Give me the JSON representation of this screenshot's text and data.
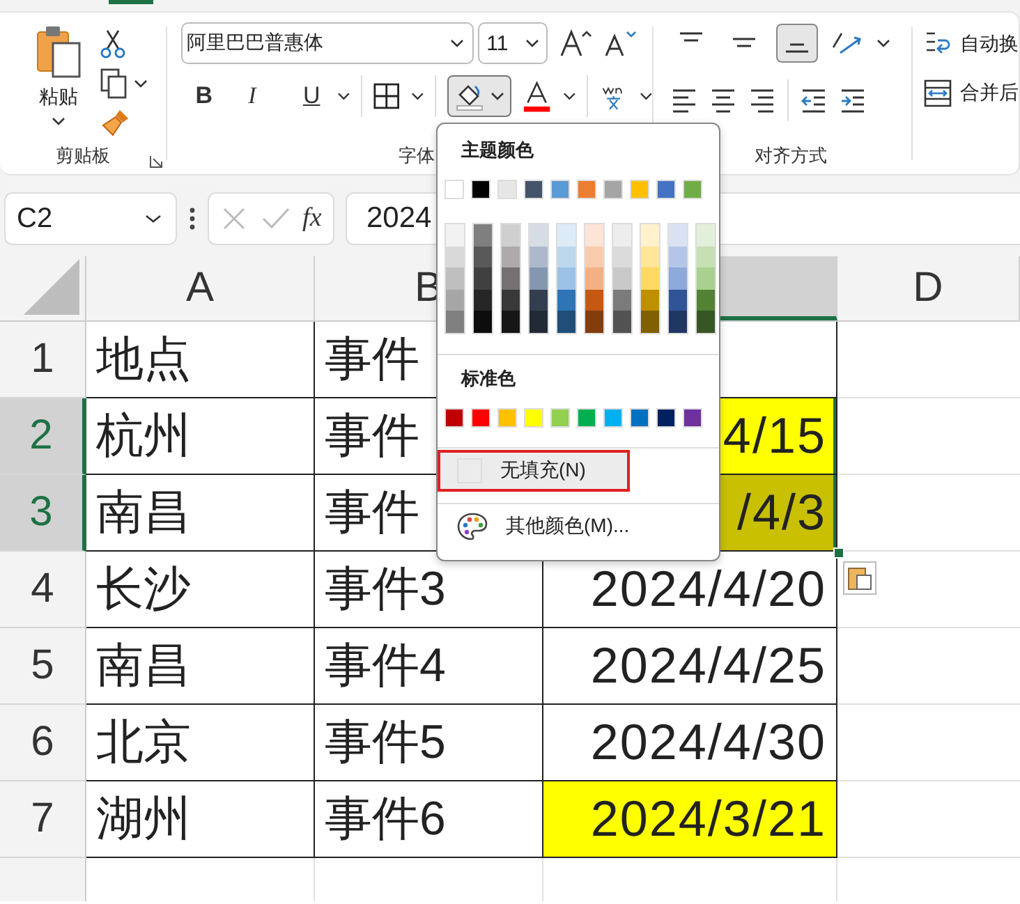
{
  "ribbon": {
    "clipboard": {
      "paste_label": "粘贴",
      "group_label": "剪贴板"
    },
    "font": {
      "font_name": "阿里巴巴普惠体",
      "font_size": "11",
      "bold": "B",
      "italic": "I",
      "underline": "U",
      "fill_pressed": true,
      "group_label": "字体"
    },
    "alignment": {
      "vertical": [
        {
          "kind": "top",
          "selected": false
        },
        {
          "kind": "middle",
          "selected": false
        },
        {
          "kind": "bottom",
          "selected": true
        }
      ],
      "wrap_label": "自动换",
      "merge_label": "合并后",
      "group_label": "对齐方式"
    }
  },
  "formula_bar": {
    "name_box": "C2",
    "fx": "fx",
    "value": "2024"
  },
  "columns": [
    {
      "label": "A",
      "selected": false
    },
    {
      "label": "B",
      "selected": false
    },
    {
      "selected": true
    },
    {
      "label": "D",
      "selected": false
    }
  ],
  "rows": [
    {
      "number": "1",
      "selected": false,
      "cells": [
        {
          "text": "地点"
        },
        {
          "text": "事件"
        },
        {},
        {}
      ]
    },
    {
      "number": "2",
      "selected": true,
      "cells": [
        {
          "text": "杭州"
        },
        {
          "text": "事件"
        },
        {
          "text": "4/15",
          "color": "#ffff00",
          "selected": true
        },
        {}
      ]
    },
    {
      "number": "3",
      "selected": true,
      "cells": [
        {
          "text": "南昌"
        },
        {
          "text": "事件"
        },
        {
          "text": "/4/3",
          "color": "#c8c000",
          "selected": true
        },
        {}
      ]
    },
    {
      "number": "4",
      "selected": false,
      "cells": [
        {
          "text": "长沙"
        },
        {
          "text": "事件3"
        },
        {
          "text": "2024/4/20",
          "selected": false
        },
        {}
      ]
    },
    {
      "number": "5",
      "selected": false,
      "cells": [
        {
          "text": "南昌"
        },
        {
          "text": "事件4"
        },
        {
          "text": "2024/4/25",
          "selected": false
        },
        {}
      ]
    },
    {
      "number": "6",
      "selected": false,
      "cells": [
        {
          "text": "北京"
        },
        {
          "text": "事件5"
        },
        {
          "text": "2024/4/30",
          "selected": false
        },
        {}
      ]
    },
    {
      "number": "7",
      "selected": false,
      "cells": [
        {
          "text": "湖州"
        },
        {
          "text": "事件6"
        },
        {
          "text": "2024/3/21",
          "color": "#ffff00",
          "selected": false
        },
        {}
      ]
    },
    {
      "cells": [
        {},
        {},
        {},
        {}
      ]
    }
  ],
  "fill_menu": {
    "theme_title": "主题颜色",
    "theme_colors": [
      {
        "color": "#ffffff"
      },
      {
        "color": "#000000"
      },
      {
        "color": "#e7e6e6"
      },
      {
        "color": "#44546a"
      },
      {
        "color": "#5b9bd5"
      },
      {
        "color": "#ed7d31"
      },
      {
        "color": "#a5a5a5"
      },
      {
        "color": "#ffc000"
      },
      {
        "color": "#4472c4"
      },
      {
        "color": "#70ad47"
      }
    ],
    "theme_shades": [
      {
        "shades": [
          {
            "color": "#f2f2f2"
          },
          {
            "color": "#d9d9d9"
          },
          {
            "color": "#bfbfbf"
          },
          {
            "color": "#a6a6a6"
          },
          {
            "color": "#808080"
          }
        ]
      },
      {
        "shades": [
          {
            "color": "#7f7f7f"
          },
          {
            "color": "#595959"
          },
          {
            "color": "#404040"
          },
          {
            "color": "#262626"
          },
          {
            "color": "#0d0d0d"
          }
        ]
      },
      {
        "shades": [
          {
            "color": "#d0cece"
          },
          {
            "color": "#aeaaaa"
          },
          {
            "color": "#757171"
          },
          {
            "color": "#3a3838"
          },
          {
            "color": "#171616"
          }
        ]
      },
      {
        "shades": [
          {
            "color": "#d6dce4"
          },
          {
            "color": "#adb9ca"
          },
          {
            "color": "#8497b0"
          },
          {
            "color": "#333f4f"
          },
          {
            "color": "#222a35"
          }
        ]
      },
      {
        "shades": [
          {
            "color": "#ddebf7"
          },
          {
            "color": "#bdd7ee"
          },
          {
            "color": "#9bc2e6"
          },
          {
            "color": "#2f75b5"
          },
          {
            "color": "#1f4e78"
          }
        ]
      },
      {
        "shades": [
          {
            "color": "#fce4d6"
          },
          {
            "color": "#f8cbad"
          },
          {
            "color": "#f4b084"
          },
          {
            "color": "#c65911"
          },
          {
            "color": "#833c0c"
          }
        ]
      },
      {
        "shades": [
          {
            "color": "#ededed"
          },
          {
            "color": "#dbdbdb"
          },
          {
            "color": "#c9c9c9"
          },
          {
            "color": "#7b7b7b"
          },
          {
            "color": "#525252"
          }
        ]
      },
      {
        "shades": [
          {
            "color": "#fff2cc"
          },
          {
            "color": "#ffe699"
          },
          {
            "color": "#ffd966"
          },
          {
            "color": "#bf8f00"
          },
          {
            "color": "#806000"
          }
        ]
      },
      {
        "shades": [
          {
            "color": "#d9e1f2"
          },
          {
            "color": "#b4c6e7"
          },
          {
            "color": "#8ea9db"
          },
          {
            "color": "#305496"
          },
          {
            "color": "#203764"
          }
        ]
      },
      {
        "shades": [
          {
            "color": "#e2efda"
          },
          {
            "color": "#c6e0b4"
          },
          {
            "color": "#a9d08e"
          },
          {
            "color": "#548235"
          },
          {
            "color": "#375623"
          }
        ]
      }
    ],
    "standard_title": "标准色",
    "standard_colors": [
      {
        "color": "#c00000"
      },
      {
        "color": "#ff0000"
      },
      {
        "color": "#ffc000"
      },
      {
        "color": "#ffff00"
      },
      {
        "color": "#92d050"
      },
      {
        "color": "#00b050"
      },
      {
        "color": "#00b0f0"
      },
      {
        "color": "#0070c0"
      },
      {
        "color": "#002060"
      },
      {
        "color": "#7030a0"
      }
    ],
    "items": [
      {
        "kind": "no-fill",
        "label": "无填充(N)",
        "selected": true
      },
      {
        "kind": "more-colors",
        "label": "其他颜色(M)...",
        "selected": false
      }
    ]
  }
}
